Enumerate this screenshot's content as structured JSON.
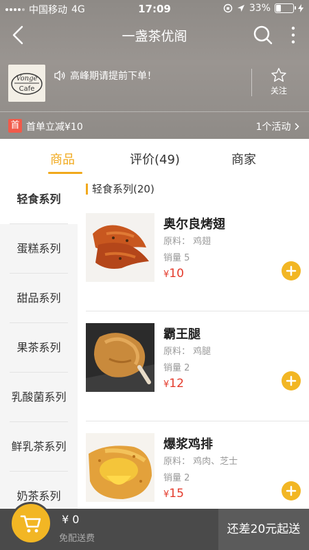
{
  "status_bar": {
    "carrier": "中国移动",
    "network": "4G",
    "time": "17:09",
    "battery": "33%",
    "battery_level": 0.33
  },
  "nav": {
    "title": "一盏茶优阁"
  },
  "shop": {
    "logo_text_top": "Vonge",
    "logo_text_bottom": "Cafe",
    "notice": "高峰期请提前下单！",
    "follow_label": "关注"
  },
  "promo": {
    "badge": "首",
    "text": "首单立减¥10",
    "activity": "1个活动"
  },
  "tabs": [
    {
      "label": "商品"
    },
    {
      "label": "评价(49)"
    },
    {
      "label": "商家"
    }
  ],
  "sidebar": {
    "categories": [
      "轻食系列",
      "蛋糕系列",
      "甜品系列",
      "果茶系列",
      "乳酸菌系列",
      "鲜乳茶系列",
      "奶茶系列"
    ]
  },
  "section": {
    "title": "轻食系列(20)"
  },
  "items": [
    {
      "name": "奥尔良烤翅",
      "ingredients": "原料：  鸡翅",
      "sales": "销量 5",
      "price": "10"
    },
    {
      "name": "霸王腿",
      "ingredients": "原料：  鸡腿",
      "sales": "销量 2",
      "price": "12"
    },
    {
      "name": "爆浆鸡排",
      "ingredients": "原料：  鸡肉、芝士",
      "sales": "销量 2",
      "price": "15"
    }
  ],
  "currency_symbol": "¥",
  "footer": {
    "amount": "¥ 0",
    "delivery": "免配送费",
    "checkout": "还差20元起送"
  },
  "colors": {
    "accent": "#f1a91c",
    "price": "#e43b2c",
    "add_button": "#f2b624",
    "footer_bg": "#4a4a4a"
  }
}
